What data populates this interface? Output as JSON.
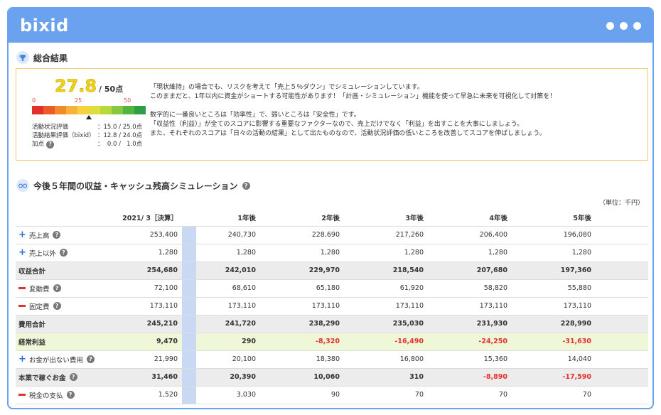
{
  "app": {
    "logo": "bixid",
    "menu_icon": "more-dots-icon"
  },
  "summary": {
    "title": "総合結果",
    "icon": "trophy-icon",
    "score": "27.8",
    "score_max": "/ 50点",
    "scale": [
      "0",
      "25",
      "50"
    ],
    "gauge_colors": [
      "#e4302a",
      "#ec5a2a",
      "#f08a2a",
      "#f5b33a",
      "#f7d13e",
      "#dddd3c",
      "#b8d93c",
      "#88c83c",
      "#55b440",
      "#2f9e44"
    ],
    "gauge_pointer_fraction": 0.556,
    "evaluations": [
      {
        "label": "活動状況評価",
        "value": "：15.0 / 25.0点",
        "help": false
      },
      {
        "label": "活動結果評価（bixid）",
        "value": "：12.8 / 24.0点",
        "help": false
      },
      {
        "label": "加点",
        "value": "：  0.0 /   1.0点",
        "help": true
      }
    ],
    "messages": [
      "「現状維持」の場合でも、リスクを考えて「売上５％ダウン」でシミュレーションしています。",
      "このままだと、1年以内に資金がショートする可能性があります！「計画・シミュレーション」機能を使って早急に未来を可視化して対策を！",
      "",
      "数字的に一番良いところは「効率性」で、弱いところは「安全性」です。",
      "「収益性（利益）」が全てのスコアに影響する重要なファクターなので、売上だけでなく「利益」を出すことを大事にしましょう。",
      "また、それぞれのスコアは「日々の活動の結果」として出たものなので、活動状況評価の低いところを改善してスコアを伸ばしましょう。"
    ]
  },
  "simulation": {
    "title": "今後５年間の収益・キャッシュ残高シミュレーション",
    "icon": "glasses-icon",
    "unit": "（単位：千円）",
    "columns": [
      "2021/ 3［決算］",
      "1年後",
      "2年後",
      "3年後",
      "4年後",
      "5年後"
    ],
    "rows": [
      {
        "name": "売上高",
        "marker": "plus",
        "help": true,
        "type": "normal",
        "values": [
          "253,400",
          "240,730",
          "228,690",
          "217,260",
          "206,400",
          "196,080"
        ]
      },
      {
        "name": "売上以外",
        "marker": "plus",
        "help": true,
        "type": "normal",
        "values": [
          "1,280",
          "1,280",
          "1,280",
          "1,280",
          "1,280",
          "1,280"
        ]
      },
      {
        "name": "収益合計",
        "marker": "",
        "help": false,
        "type": "total",
        "values": [
          "254,680",
          "242,010",
          "229,970",
          "218,540",
          "207,680",
          "197,360"
        ]
      },
      {
        "name": "変動費",
        "marker": "minus",
        "help": true,
        "type": "normal",
        "values": [
          "72,100",
          "68,610",
          "65,180",
          "61,920",
          "58,820",
          "55,880"
        ]
      },
      {
        "name": "固定費",
        "marker": "minus",
        "help": true,
        "type": "normal",
        "values": [
          "173,110",
          "173,110",
          "173,110",
          "173,110",
          "173,110",
          "173,110"
        ]
      },
      {
        "name": "費用合計",
        "marker": "",
        "help": false,
        "type": "total",
        "values": [
          "245,210",
          "241,720",
          "238,290",
          "235,030",
          "231,930",
          "228,990"
        ]
      },
      {
        "name": "経常利益",
        "marker": "",
        "help": false,
        "type": "profit",
        "values": [
          "9,470",
          "290",
          "-8,320",
          "-16,490",
          "-24,250",
          "-31,630"
        ]
      },
      {
        "name": "お金が出ない費用",
        "marker": "plus",
        "help": true,
        "type": "normal",
        "values": [
          "21,990",
          "20,100",
          "18,380",
          "16,800",
          "15,360",
          "14,040"
        ]
      },
      {
        "name": "本業で稼ぐお金",
        "marker": "",
        "help": true,
        "type": "total",
        "values": [
          "31,460",
          "20,390",
          "10,060",
          "310",
          "-8,890",
          "-17,590"
        ]
      },
      {
        "name": "税金の支払",
        "marker": "minus",
        "help": true,
        "type": "normal",
        "values": [
          "1,520",
          "3,030",
          "90",
          "70",
          "70",
          "70"
        ]
      }
    ]
  }
}
